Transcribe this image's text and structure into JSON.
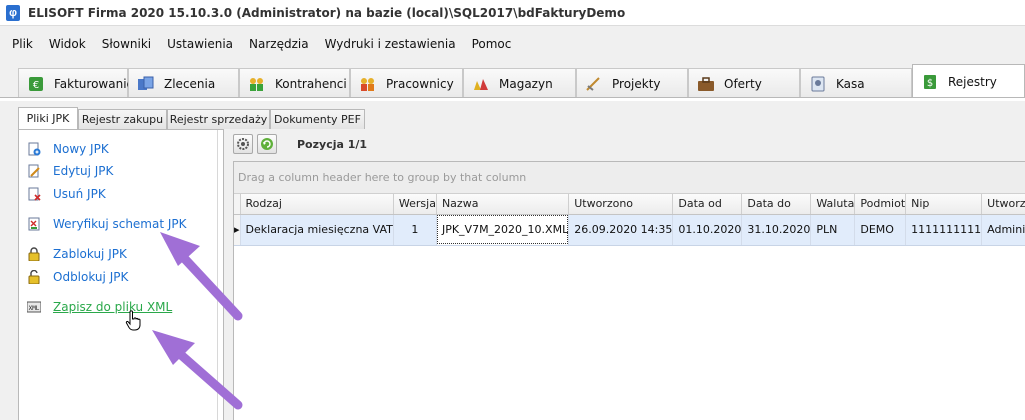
{
  "window": {
    "title": "ELISOFT Firma 2020 15.10.3.0  (Administrator) na bazie (local)\\SQL2017\\bdFakturyDemo",
    "icon": "app-icon"
  },
  "menu": [
    "Plik",
    "Widok",
    "Słowniki",
    "Ustawienia",
    "Narzędzia",
    "Wydruki i zestawienia",
    "Pomoc"
  ],
  "module_tabs": [
    {
      "label": "Fakturowanie",
      "icon": "invoice-icon"
    },
    {
      "label": "Zlecenia",
      "icon": "orders-icon"
    },
    {
      "label": "Kontrahenci",
      "icon": "contractors-icon"
    },
    {
      "label": "Pracownicy",
      "icon": "employees-icon"
    },
    {
      "label": "Magazyn",
      "icon": "warehouse-icon"
    },
    {
      "label": "Projekty",
      "icon": "projects-icon"
    },
    {
      "label": "Oferty",
      "icon": "briefcase-icon"
    },
    {
      "label": "Kasa",
      "icon": "cash-icon"
    },
    {
      "label": "Rejestry",
      "icon": "registers-icon",
      "active": true
    }
  ],
  "sub_tabs": [
    {
      "label": "Pliki JPK",
      "active": true
    },
    {
      "label": "Rejestr zakupu"
    },
    {
      "label": "Rejestr sprzedaży"
    },
    {
      "label": "Dokumenty PEF"
    }
  ],
  "actions": [
    {
      "label": "Nowy JPK",
      "icon": "new-document-icon"
    },
    {
      "label": "Edytuj JPK",
      "icon": "edit-document-icon"
    },
    {
      "label": "Usuń JPK",
      "icon": "delete-document-icon"
    },
    {
      "label": "Weryfikuj schemat JPK",
      "icon": "verify-schema-icon"
    },
    {
      "label": "Zablokuj JPK",
      "icon": "lock-icon"
    },
    {
      "label": "Odblokuj JPK",
      "icon": "unlock-icon"
    },
    {
      "label": "Zapisz do pliku XML",
      "icon": "xml-file-icon",
      "hover": true
    }
  ],
  "toolbar": {
    "position_text": "Pozycja 1/1",
    "settings_icon": "gear-icon",
    "refresh_icon": "refresh-icon"
  },
  "grid": {
    "group_hint": "Drag a column header here to group by that column",
    "columns": [
      "Rodzaj",
      "Wersja",
      "Nazwa",
      "Utworzono",
      "Data od",
      "Data do",
      "Waluta",
      "Podmiot",
      "Nip",
      "Utworzył"
    ],
    "rows": [
      [
        "Deklaracja miesięczna VAT",
        "1",
        "JPK_V7M_2020_10.XML",
        "26.09.2020 14:35",
        "01.10.2020",
        "31.10.2020",
        "PLN",
        "DEMO",
        "1111111111",
        "Administrator"
      ]
    ],
    "row_indicator": "▸"
  },
  "colors": {
    "link": "#1c6fd1",
    "link_hover": "#2aa84a",
    "selection": "#e1ecfb",
    "arrow": "#a06fd6"
  }
}
